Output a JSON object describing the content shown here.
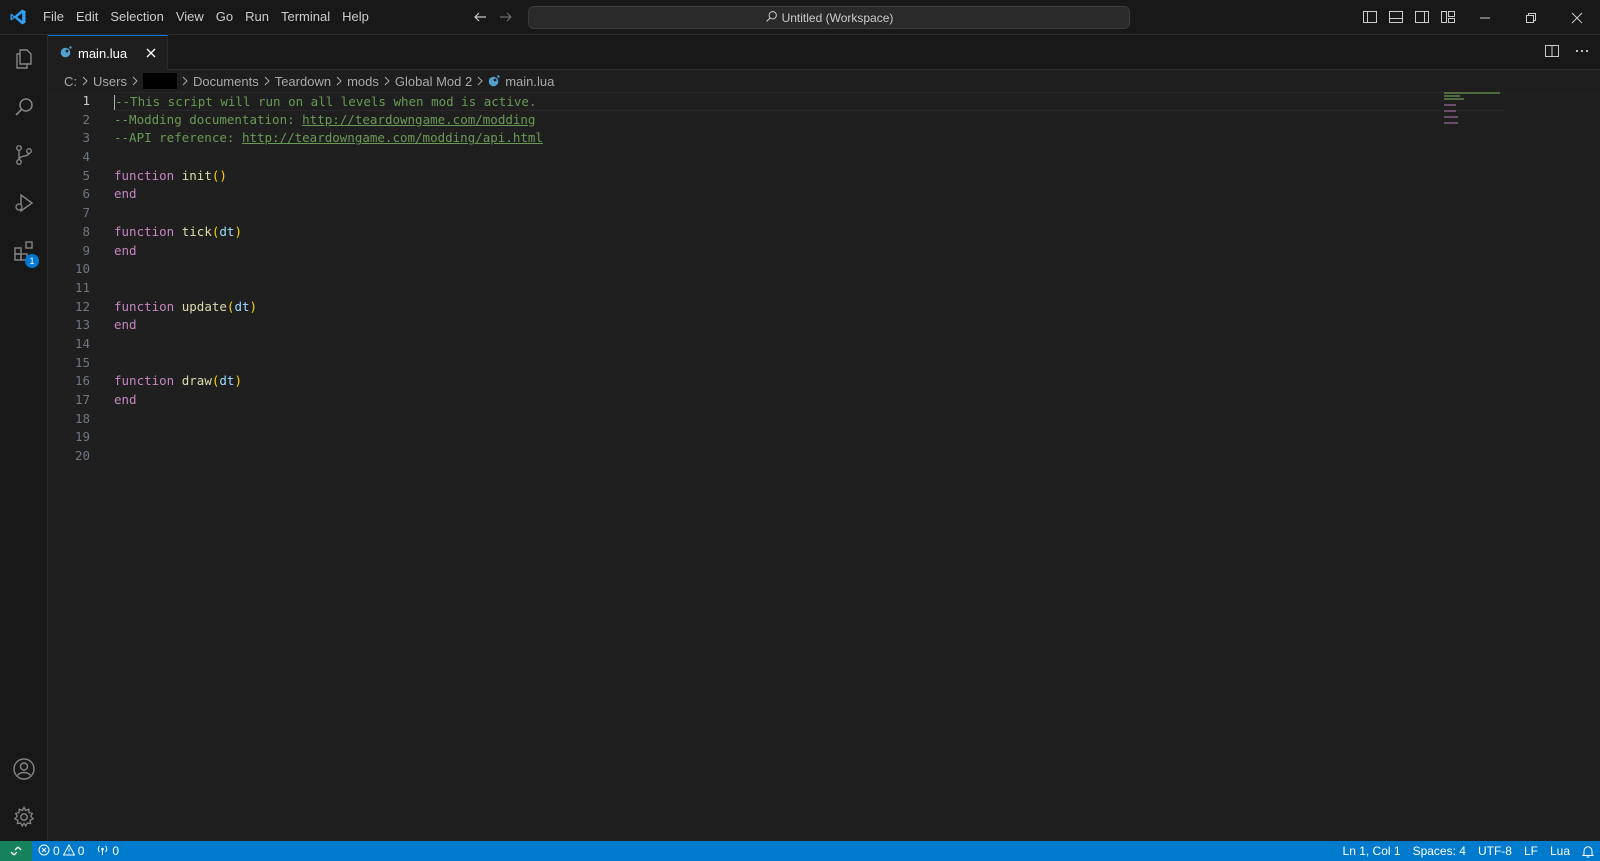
{
  "window": {
    "title": "Untitled (Workspace)"
  },
  "menu": {
    "items": [
      "File",
      "Edit",
      "Selection",
      "View",
      "Go",
      "Run",
      "Terminal",
      "Help"
    ]
  },
  "activity_bar": {
    "items": [
      "explorer-icon",
      "search-icon",
      "source-control-icon",
      "run-debug-icon",
      "extensions-icon"
    ],
    "extensions_badge": "1",
    "bottom_items": [
      "account-icon",
      "gear-icon"
    ]
  },
  "tab": {
    "label": "main.lua"
  },
  "breadcrumb": {
    "items": [
      "C:",
      "Users",
      "",
      "Documents",
      "Teardown",
      "mods",
      "Global Mod 2",
      "main.lua"
    ]
  },
  "editor": {
    "active_line": 1,
    "line_numbers": [
      "1",
      "2",
      "3",
      "4",
      "5",
      "6",
      "7",
      "8",
      "9",
      "10",
      "11",
      "12",
      "13",
      "14",
      "15",
      "16",
      "17",
      "18",
      "19",
      "20"
    ],
    "lines": {
      "l1": "--This script will run on all levels when mod is active.",
      "l2_comment": "--Modding documentation: ",
      "l2_url": "http://teardowngame.com/modding",
      "l3_comment": "--API reference: ",
      "l3_url": "http://teardowngame.com/modding/api.html",
      "keyword_function": "function",
      "keyword_end": "end",
      "fn_init": "init",
      "fn_tick": "tick",
      "fn_update": "update",
      "fn_draw": "draw",
      "param_dt": "dt",
      "paren_open": "(",
      "paren_close": ")"
    }
  },
  "status_bar": {
    "errors": "0",
    "warnings": "0",
    "ports": "0",
    "position": "Ln 1, Col 1",
    "spaces": "Spaces: 4",
    "encoding": "UTF-8",
    "eol": "LF",
    "language": "Lua"
  },
  "colors": {
    "accent": "#0078d4",
    "statusbar": "#007acc",
    "comment": "#6a9955",
    "keyword": "#c586c0",
    "function": "#dcdcaa"
  }
}
